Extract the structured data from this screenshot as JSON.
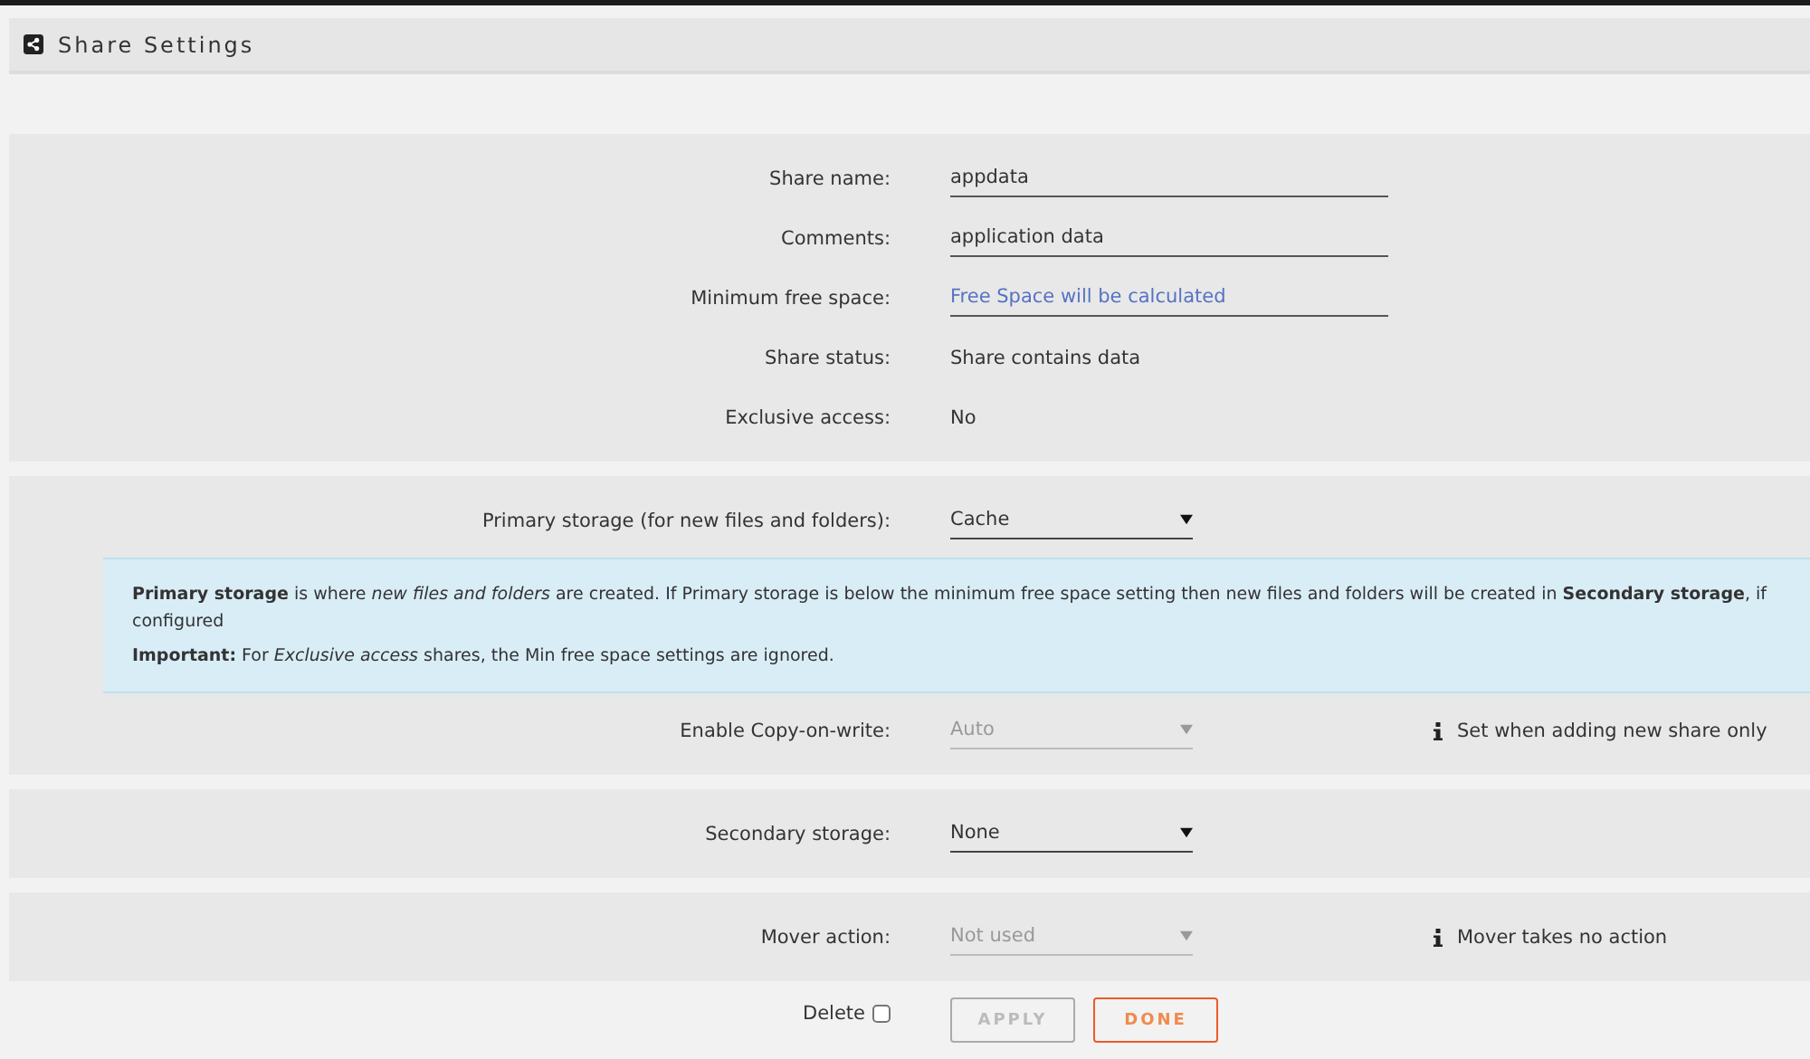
{
  "header": {
    "title": "Share Settings"
  },
  "sections": [
    {
      "rows": [
        {
          "kind": "field",
          "label": "Share name:",
          "value": "appdata"
        },
        {
          "kind": "field",
          "label": "Comments:",
          "value": "application data"
        },
        {
          "kind": "field",
          "label": "Minimum free space:",
          "placeholder": "Free Space will be calculated"
        },
        {
          "kind": "static",
          "label": "Share status:",
          "value": "Share contains data"
        },
        {
          "kind": "static",
          "label": "Exclusive access:",
          "value": "No"
        }
      ]
    },
    {
      "rows": [
        {
          "kind": "select",
          "label": "Primary storage (for new files and folders):",
          "value": "Cache",
          "disabled": false
        },
        {
          "kind": "info",
          "lines": [
            "**Primary storage** is where *new files and folders* are created. If Primary storage is below the minimum free space setting then new files and folders will be created in **Secondary storage**, if configured",
            "**Important:** For *Exclusive access* shares, the Min free space settings are ignored."
          ]
        },
        {
          "kind": "select",
          "label": "Enable Copy-on-write:",
          "value": "Auto",
          "disabled": true,
          "note": "Set when adding new share only"
        }
      ]
    },
    {
      "rows": [
        {
          "kind": "select",
          "label": "Secondary storage:",
          "value": "None",
          "disabled": false
        }
      ]
    },
    {
      "rows": [
        {
          "kind": "select",
          "label": "Mover action:",
          "value": "Not used",
          "disabled": true,
          "note": "Mover takes no action"
        }
      ]
    }
  ],
  "footer": {
    "delete_label": "Delete",
    "delete_checked": false,
    "buttons": [
      {
        "label": "APPLY",
        "kind": "apply",
        "disabled": true
      },
      {
        "label": "DONE",
        "kind": "done",
        "disabled": false
      }
    ]
  }
}
